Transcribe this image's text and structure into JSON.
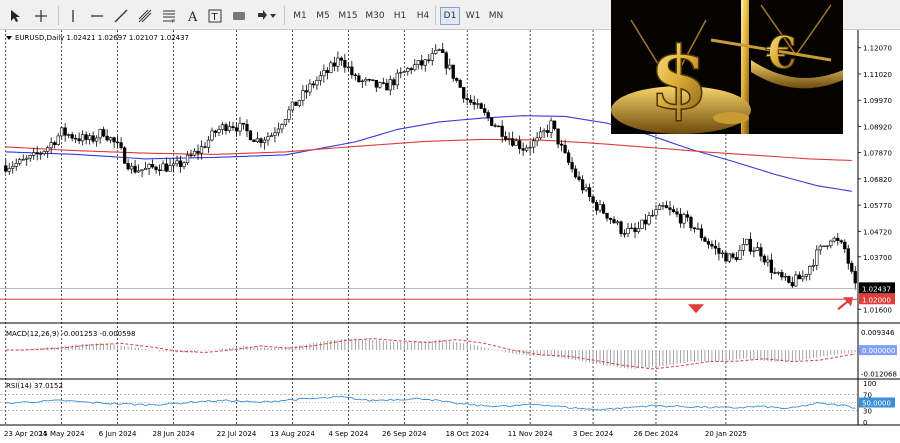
{
  "toolbar": {
    "tools": [
      "cursor",
      "crosshair",
      "vertical-line",
      "horizontal-line",
      "trendline",
      "channel",
      "fibonacci",
      "text",
      "text-label",
      "rectangle",
      "arrow-shapes"
    ],
    "timeframes": [
      "M1",
      "M5",
      "M15",
      "M30",
      "H1",
      "H4",
      "D1",
      "W1",
      "MN"
    ],
    "active_timeframe": "D1"
  },
  "chart_data": [
    {
      "type": "candlestick",
      "panel": "price",
      "header": "EURUSD,Daily  1.02421 1.02697 1.02107 1.02437",
      "ylim": [
        1.0125,
        1.127
      ],
      "y_ticks": [
        "1.12070",
        "1.11020",
        "1.09970",
        "1.08920",
        "1.07870",
        "1.06820",
        "1.05770",
        "1.04720",
        "1.03700",
        "1.02650",
        "1.01600"
      ],
      "x_ticks": [
        "23 Apr 2024",
        "15 May 2024",
        "6 Jun 2024",
        "28 Jun 2024",
        "22 Jul 2024",
        "13 Aug 2024",
        "4 Sep 2024",
        "26 Sep 2024",
        "18 Oct 2024",
        "11 Nov 2024",
        "3 Dec 2024",
        "26 Dec 2024",
        "20 Jan 2025"
      ],
      "close_path": [
        [
          0,
          1.0735
        ],
        [
          4,
          1.0745
        ],
        [
          8,
          1.0768
        ],
        [
          12,
          1.081
        ],
        [
          16,
          1.0868
        ],
        [
          20,
          1.085
        ],
        [
          24,
          1.0835
        ],
        [
          28,
          1.0872
        ],
        [
          32,
          1.081
        ],
        [
          36,
          1.0722
        ],
        [
          40,
          1.0718
        ],
        [
          44,
          1.0735
        ],
        [
          48,
          1.0725
        ],
        [
          52,
          1.076
        ],
        [
          56,
          1.0805
        ],
        [
          60,
          1.087
        ],
        [
          64,
          1.0905
        ],
        [
          68,
          1.088
        ],
        [
          72,
          1.0838
        ],
        [
          76,
          1.086
        ],
        [
          80,
          1.0935
        ],
        [
          84,
          1.1
        ],
        [
          88,
          1.1065
        ],
        [
          92,
          1.111
        ],
        [
          96,
          1.117
        ],
        [
          100,
          1.1078
        ],
        [
          104,
          1.1062
        ],
        [
          108,
          1.1045
        ],
        [
          112,
          1.1085
        ],
        [
          116,
          1.113
        ],
        [
          120,
          1.1145
        ],
        [
          124,
          1.119
        ],
        [
          128,
          1.1098
        ],
        [
          132,
          1.1
        ],
        [
          136,
          1.095
        ],
        [
          140,
          1.09
        ],
        [
          144,
          1.0848
        ],
        [
          148,
          1.0808
        ],
        [
          152,
          1.0832
        ],
        [
          156,
          1.09
        ],
        [
          160,
          1.077
        ],
        [
          164,
          1.067
        ],
        [
          168,
          1.0585
        ],
        [
          172,
          1.054
        ],
        [
          176,
          1.048
        ],
        [
          180,
          1.0465
        ],
        [
          184,
          1.0525
        ],
        [
          188,
          1.0565
        ],
        [
          192,
          1.0535
        ],
        [
          196,
          1.05
        ],
        [
          200,
          1.044
        ],
        [
          204,
          1.0385
        ],
        [
          208,
          1.036
        ],
        [
          212,
          1.042
        ],
        [
          216,
          1.039
        ],
        [
          220,
          1.03
        ],
        [
          224,
          1.026
        ],
        [
          228,
          1.029
        ],
        [
          232,
          1.038
        ],
        [
          236,
          1.045
        ],
        [
          240,
          1.04
        ],
        [
          243,
          1.02437
        ]
      ],
      "moving_averages": [
        {
          "color": "#3b3bdc",
          "values": [
            [
              0,
              1.079
            ],
            [
              20,
              1.078
            ],
            [
              40,
              1.0762
            ],
            [
              60,
              1.0768
            ],
            [
              80,
              1.0778
            ],
            [
              100,
              1.083
            ],
            [
              112,
              1.088
            ],
            [
              124,
              1.091
            ],
            [
              136,
              1.0925
            ],
            [
              148,
              1.0935
            ],
            [
              160,
              1.0932
            ],
            [
              172,
              1.0905
            ],
            [
              184,
              1.0858
            ],
            [
              196,
              1.08
            ],
            [
              208,
              1.0752
            ],
            [
              220,
              1.07
            ],
            [
              232,
              1.0655
            ],
            [
              243,
              1.063
            ]
          ]
        },
        {
          "color": "#e03c3c",
          "values": [
            [
              0,
              1.081
            ],
            [
              20,
              1.0795
            ],
            [
              40,
              1.0785
            ],
            [
              60,
              1.078
            ],
            [
              80,
              1.079
            ],
            [
              100,
              1.0812
            ],
            [
              120,
              1.0832
            ],
            [
              136,
              1.084
            ],
            [
              152,
              1.0838
            ],
            [
              168,
              1.0825
            ],
            [
              184,
              1.0808
            ],
            [
              200,
              1.079
            ],
            [
              216,
              1.0775
            ],
            [
              230,
              1.0762
            ],
            [
              243,
              1.0755
            ]
          ]
        }
      ],
      "current_price_label": "1.02437",
      "current_price_color": "#000000",
      "level_label": "1.02000",
      "level_value": 1.02,
      "level_color": "#e03c3c",
      "current_price": 1.02437
    },
    {
      "type": "histogram",
      "panel": "macd",
      "header": "MACD(12,26,9) -0.001253 -0.000598",
      "y_ticks": [
        "0.009346",
        "0.000000",
        "-0.012068"
      ],
      "ylim": [
        -0.0135,
        0.0105
      ],
      "zero_label_color": "#7f9fff",
      "signal_color": "#e03c3c",
      "values": [
        [
          0,
          0.0
        ],
        [
          10,
          0.001
        ],
        [
          20,
          0.0028
        ],
        [
          28,
          0.0035
        ],
        [
          36,
          0.0018
        ],
        [
          44,
          -0.0005
        ],
        [
          52,
          -0.0012
        ],
        [
          60,
          0.0002
        ],
        [
          68,
          0.0022
        ],
        [
          76,
          0.001
        ],
        [
          84,
          0.0025
        ],
        [
          92,
          0.005
        ],
        [
          100,
          0.006
        ],
        [
          108,
          0.0048
        ],
        [
          116,
          0.004
        ],
        [
          124,
          0.0055
        ],
        [
          132,
          0.0035
        ],
        [
          140,
          0.0
        ],
        [
          148,
          -0.0025
        ],
        [
          156,
          -0.0032
        ],
        [
          164,
          -0.0055
        ],
        [
          172,
          -0.008
        ],
        [
          180,
          -0.0098
        ],
        [
          188,
          -0.0082
        ],
        [
          196,
          -0.006
        ],
        [
          204,
          -0.0058
        ],
        [
          212,
          -0.0045
        ],
        [
          220,
          -0.006
        ],
        [
          228,
          -0.0052
        ],
        [
          236,
          -0.0025
        ],
        [
          243,
          -0.0012
        ]
      ]
    },
    {
      "type": "line",
      "panel": "rsi",
      "header": "RSI(14) 37.0152",
      "y_ticks": [
        "100",
        "70",
        "50.0000",
        "30",
        "0"
      ],
      "ylim": [
        0,
        100
      ],
      "line_color": "#3a8fd8",
      "values": [
        [
          0,
          48
        ],
        [
          8,
          52
        ],
        [
          16,
          55
        ],
        [
          24,
          50
        ],
        [
          32,
          47
        ],
        [
          40,
          44
        ],
        [
          48,
          47
        ],
        [
          56,
          53
        ],
        [
          64,
          55
        ],
        [
          72,
          50
        ],
        [
          80,
          56
        ],
        [
          88,
          60
        ],
        [
          96,
          64
        ],
        [
          104,
          55
        ],
        [
          112,
          58
        ],
        [
          120,
          60
        ],
        [
          128,
          48
        ],
        [
          136,
          42
        ],
        [
          144,
          40
        ],
        [
          152,
          46
        ],
        [
          160,
          38
        ],
        [
          168,
          32
        ],
        [
          176,
          35
        ],
        [
          184,
          42
        ],
        [
          192,
          40
        ],
        [
          200,
          38
        ],
        [
          208,
          36
        ],
        [
          216,
          40
        ],
        [
          224,
          34
        ],
        [
          232,
          48
        ],
        [
          240,
          42
        ],
        [
          243,
          37
        ]
      ]
    }
  ]
}
